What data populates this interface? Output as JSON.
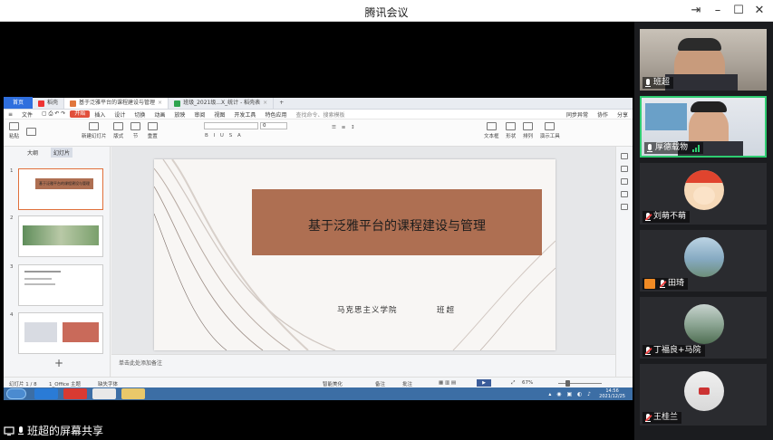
{
  "window": {
    "title": "腾讯会议"
  },
  "share": {
    "label": "班超的屏幕共享"
  },
  "wps": {
    "tabs": [
      {
        "label": "首页"
      },
      {
        "label": "稻壳"
      },
      {
        "label": "基于泛雅平台的课程建设与管理"
      },
      {
        "label": "班级_2021级...X_统计 - 稻壳表"
      }
    ],
    "menu": [
      "文件",
      "开始",
      "插入",
      "设计",
      "切换",
      "动画",
      "放映",
      "审阅",
      "视图",
      "开发工具",
      "特色应用"
    ],
    "menu_right": [
      "查找命令、搜索模板",
      "同步异常",
      "协作",
      "分享"
    ],
    "ribbon": {
      "groups": [
        "粘贴",
        "新建幻灯片",
        "版式",
        "节",
        "重置",
        "文本框",
        "形状",
        "排列",
        "演示工具"
      ],
      "font_size": "0"
    },
    "thumb_tabs": [
      "大纲",
      "幻灯片"
    ],
    "thumb_numbers": [
      "1",
      "2",
      "3",
      "4"
    ],
    "thumb1_title": "基于泛雅平台的课程建设与管理",
    "notes_placeholder": "单击此处添加备注",
    "status": {
      "slide_count": "幻灯片 1 / 8",
      "theme": "1_Office 主题",
      "font_missing": "缺失字体",
      "smart_beautify": "智能美化",
      "notes": "备注",
      "annotate": "批注",
      "zoom": "67%"
    },
    "taskbar_clock": {
      "time": "14:56",
      "date": "2021/12/25"
    }
  },
  "slide": {
    "title": "基于泛雅平台的课程建设与管理",
    "subtitle": "马克思主义学院",
    "author": "班超"
  },
  "participants": [
    {
      "name": "班超",
      "muted": false
    },
    {
      "name": "厚德载物",
      "muted": false,
      "speaking": true
    },
    {
      "name": "刘萌不萌",
      "muted": true
    },
    {
      "name": "田琦",
      "muted": true
    },
    {
      "name": "丁福良+马院",
      "muted": true
    },
    {
      "name": "王桂兰",
      "muted": true
    }
  ],
  "colors": {
    "slide_accent": "#ae6f52",
    "wps_accent": "#e1503c",
    "active_speaker": "#2ecc71"
  }
}
